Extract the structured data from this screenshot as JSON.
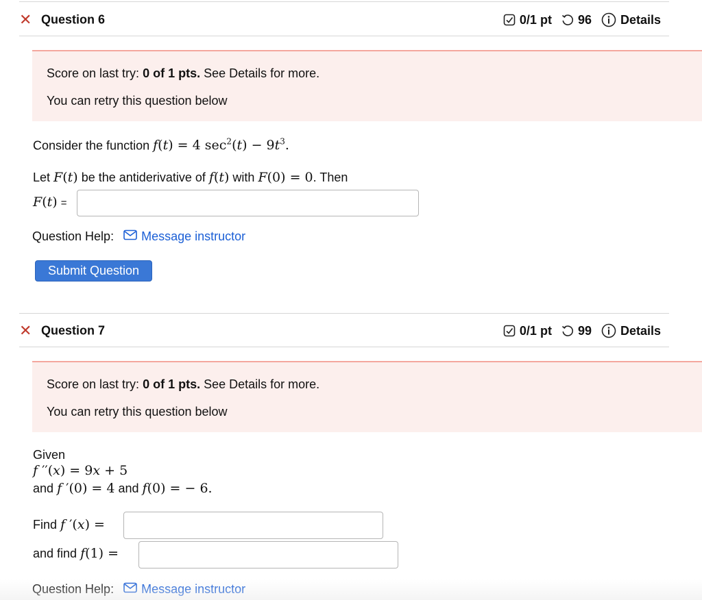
{
  "questions": [
    {
      "title": "Question 6",
      "score": "0/1 pt",
      "attempts": "96",
      "details_label": "Details",
      "score_prefix": "Score on last try: ",
      "score_value": "0 of 1 pts.",
      "score_suffix": " See Details for more.",
      "retry_text": "You can retry this question below",
      "body_intro": "Consider the function",
      "body_let": "Let",
      "body_antideriv": "be the antiderivative of",
      "body_with": "with",
      "body_then": ". Then",
      "answer_label": "=",
      "answer_value": "",
      "help_label": "Question Help:",
      "message_label": "Message instructor",
      "submit_label": "Submit Question"
    },
    {
      "title": "Question 7",
      "score": "0/1 pt",
      "attempts": "99",
      "details_label": "Details",
      "score_prefix": "Score on last try: ",
      "score_value": "0 of 1 pts.",
      "score_suffix": " See Details for more.",
      "retry_text": "You can retry this question below",
      "given_label": "Given",
      "and_label": "and",
      "and_label2": "and",
      "find_label": "Find",
      "and_find_label": "and find",
      "answer1_value": "",
      "answer2_value": "",
      "help_label": "Question Help:",
      "message_label": "Message instructor"
    }
  ],
  "colors": {
    "error_x": "#c0392b",
    "score_bg": "#fcefed",
    "score_border": "#f4a79e",
    "link": "#1b5fd6",
    "button": "#3a78d6"
  },
  "icons": [
    "close-x-icon",
    "checkbox-score-icon",
    "retry-icon",
    "info-icon",
    "envelope-icon"
  ]
}
